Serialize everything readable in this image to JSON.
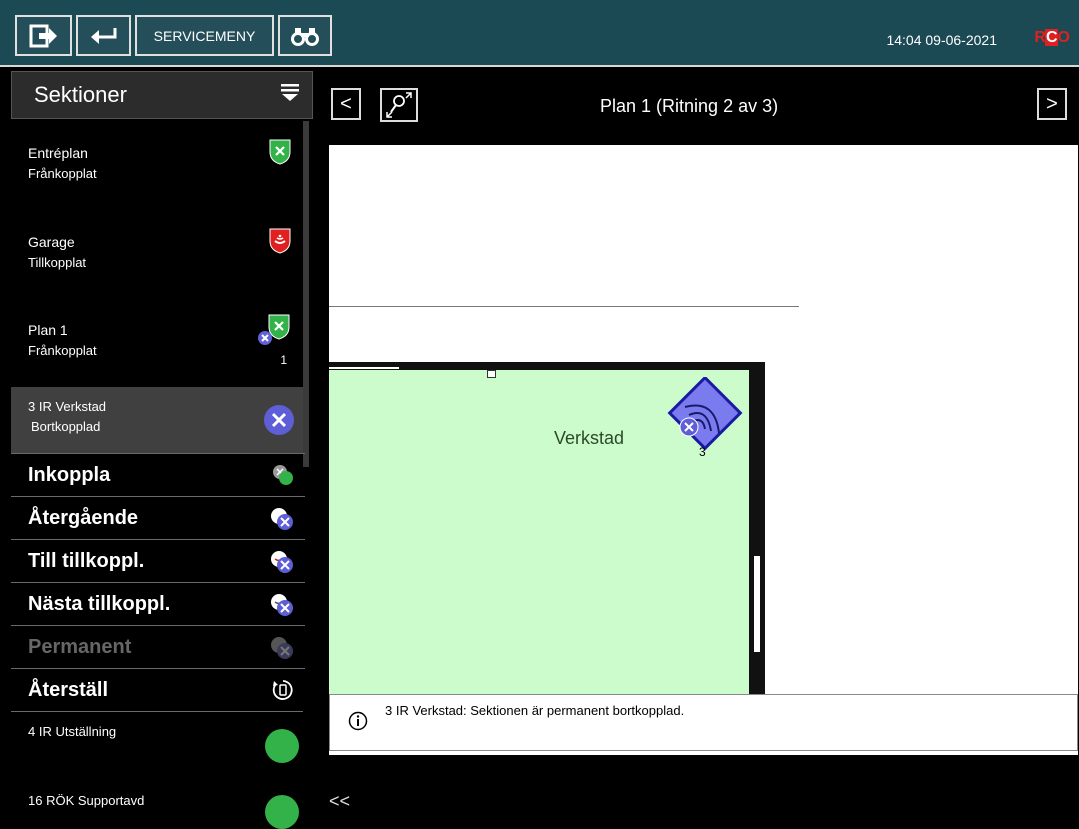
{
  "topbar": {
    "service_label": "SERVICEMENY",
    "datetime": "14:04  09-06-2021",
    "logo": {
      "r": "R",
      "c": "C",
      "o": "O"
    }
  },
  "sidebar": {
    "title": "Sektioner",
    "sections": [
      {
        "name": "Entréplan",
        "status": "Frånkopplat",
        "icon": "shield-green-x-icon"
      },
      {
        "name": "Garage",
        "status": "Tillkopplat",
        "icon": "shield-red-alarm-icon"
      },
      {
        "name": "Plan 1",
        "status": "Frånkopplat",
        "icon": "shield-green-x-icon",
        "count": "1"
      },
      {
        "name": "3 IR Verkstad",
        "status": "Bortkopplad",
        "icon": "bypass-x-icon"
      }
    ],
    "actions": [
      {
        "label": "Inkoppla",
        "icon": "connect-icon"
      },
      {
        "label": "Återgående",
        "icon": "return-bypass-icon"
      },
      {
        "label": "Till tillkoppl.",
        "icon": "arm-bypass-icon"
      },
      {
        "label": "Nästa tillkoppl.",
        "icon": "next-arm-bypass-icon"
      },
      {
        "label": "Permanent",
        "icon": "permanent-bypass-icon"
      },
      {
        "label": "Återställ",
        "icon": "reset-icon"
      }
    ],
    "zones": [
      {
        "name": "4 IR Utställning"
      },
      {
        "name": "16 RÖK Supportavd"
      }
    ]
  },
  "main": {
    "prev_label": "<",
    "next_label": ">",
    "plan_title": "Plan 1    (Ritning 2 av 3)",
    "room_label": "Verkstad",
    "detector_number": "3",
    "info_message": "3 IR Verkstad:  Sektionen är permanent bortkopplad.",
    "collapse_label": "<<"
  },
  "colors": {
    "topbar": "#1b4a55",
    "room": "#ccfccc",
    "detector": "#7b7bf0",
    "status_green": "#33b24a",
    "status_red": "#e02020"
  }
}
